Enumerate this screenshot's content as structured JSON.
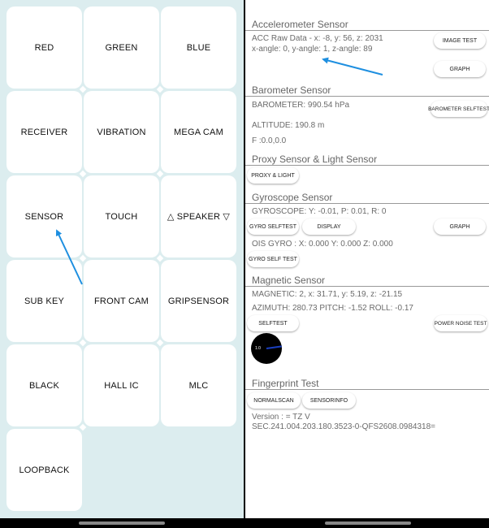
{
  "tiles": [
    {
      "label": "RED"
    },
    {
      "label": "GREEN"
    },
    {
      "label": "BLUE"
    },
    {
      "label": "RECEIVER"
    },
    {
      "label": "VIBRATION"
    },
    {
      "label": "MEGA CAM"
    },
    {
      "label": "SENSOR"
    },
    {
      "label": "TOUCH"
    },
    {
      "label": "△ SPEAKER ▽"
    },
    {
      "label": "SUB KEY"
    },
    {
      "label": "FRONT CAM"
    },
    {
      "label": "GRIPSENSOR"
    },
    {
      "label": "BLACK"
    },
    {
      "label": "HALL IC"
    },
    {
      "label": "MLC"
    },
    {
      "label": "LOOPBACK"
    }
  ],
  "accel": {
    "title": "Accelerometer Sensor",
    "raw": "ACC Raw Data - x: -8, y: 56, z: 2031",
    "angles": "x-angle: 0, y-angle: 1, z-angle: 89",
    "image_test": "IMAGE TEST",
    "graph": "GRAPH"
  },
  "baro": {
    "title": "Barometer Sensor",
    "value": "BAROMETER: 990.54 hPa",
    "altitude": "ALTITUDE: 190.8 m",
    "f": "F :0.0,0.0",
    "selftest": "BAROMETER SELFTEST"
  },
  "proxy": {
    "title": "Proxy Sensor & Light Sensor",
    "button": "PROXY & LIGHT"
  },
  "gyro": {
    "title": "Gyroscope Sensor",
    "value": "GYROSCOPE: Y: -0.01, P: 0.01, R: 0",
    "selftest": "GYRO SELFTEST",
    "display": "DISPLAY",
    "graph": "GRAPH",
    "ois": "OIS GYRO : X: 0.000  Y: 0.000  Z: 0.000",
    "gyro_self_test": "GYRO SELF TEST"
  },
  "mag": {
    "title": "Magnetic Sensor",
    "value": "MAGNETIC: 2, x: 31.71, y: 5.19, z: -21.15",
    "azimuth": "AZIMUTH: 280.73   PITCH: -1.52   ROLL: -0.17",
    "selftest": "SELFTEST",
    "power_noise": "POWER NOISE TEST",
    "compass_label": "1.0"
  },
  "finger": {
    "title": "Fingerprint Test",
    "normalscan": "NORMALSCAN",
    "sensorinfo": "SENSORINFO",
    "version": "Version : = TZ V",
    "sec": "SEC.241.004.203.180.3523-0-QFS2608.0984318="
  },
  "colors": {
    "left_bg": "#dcedef",
    "arrow": "#1e8fe0",
    "divider": "#999999"
  }
}
